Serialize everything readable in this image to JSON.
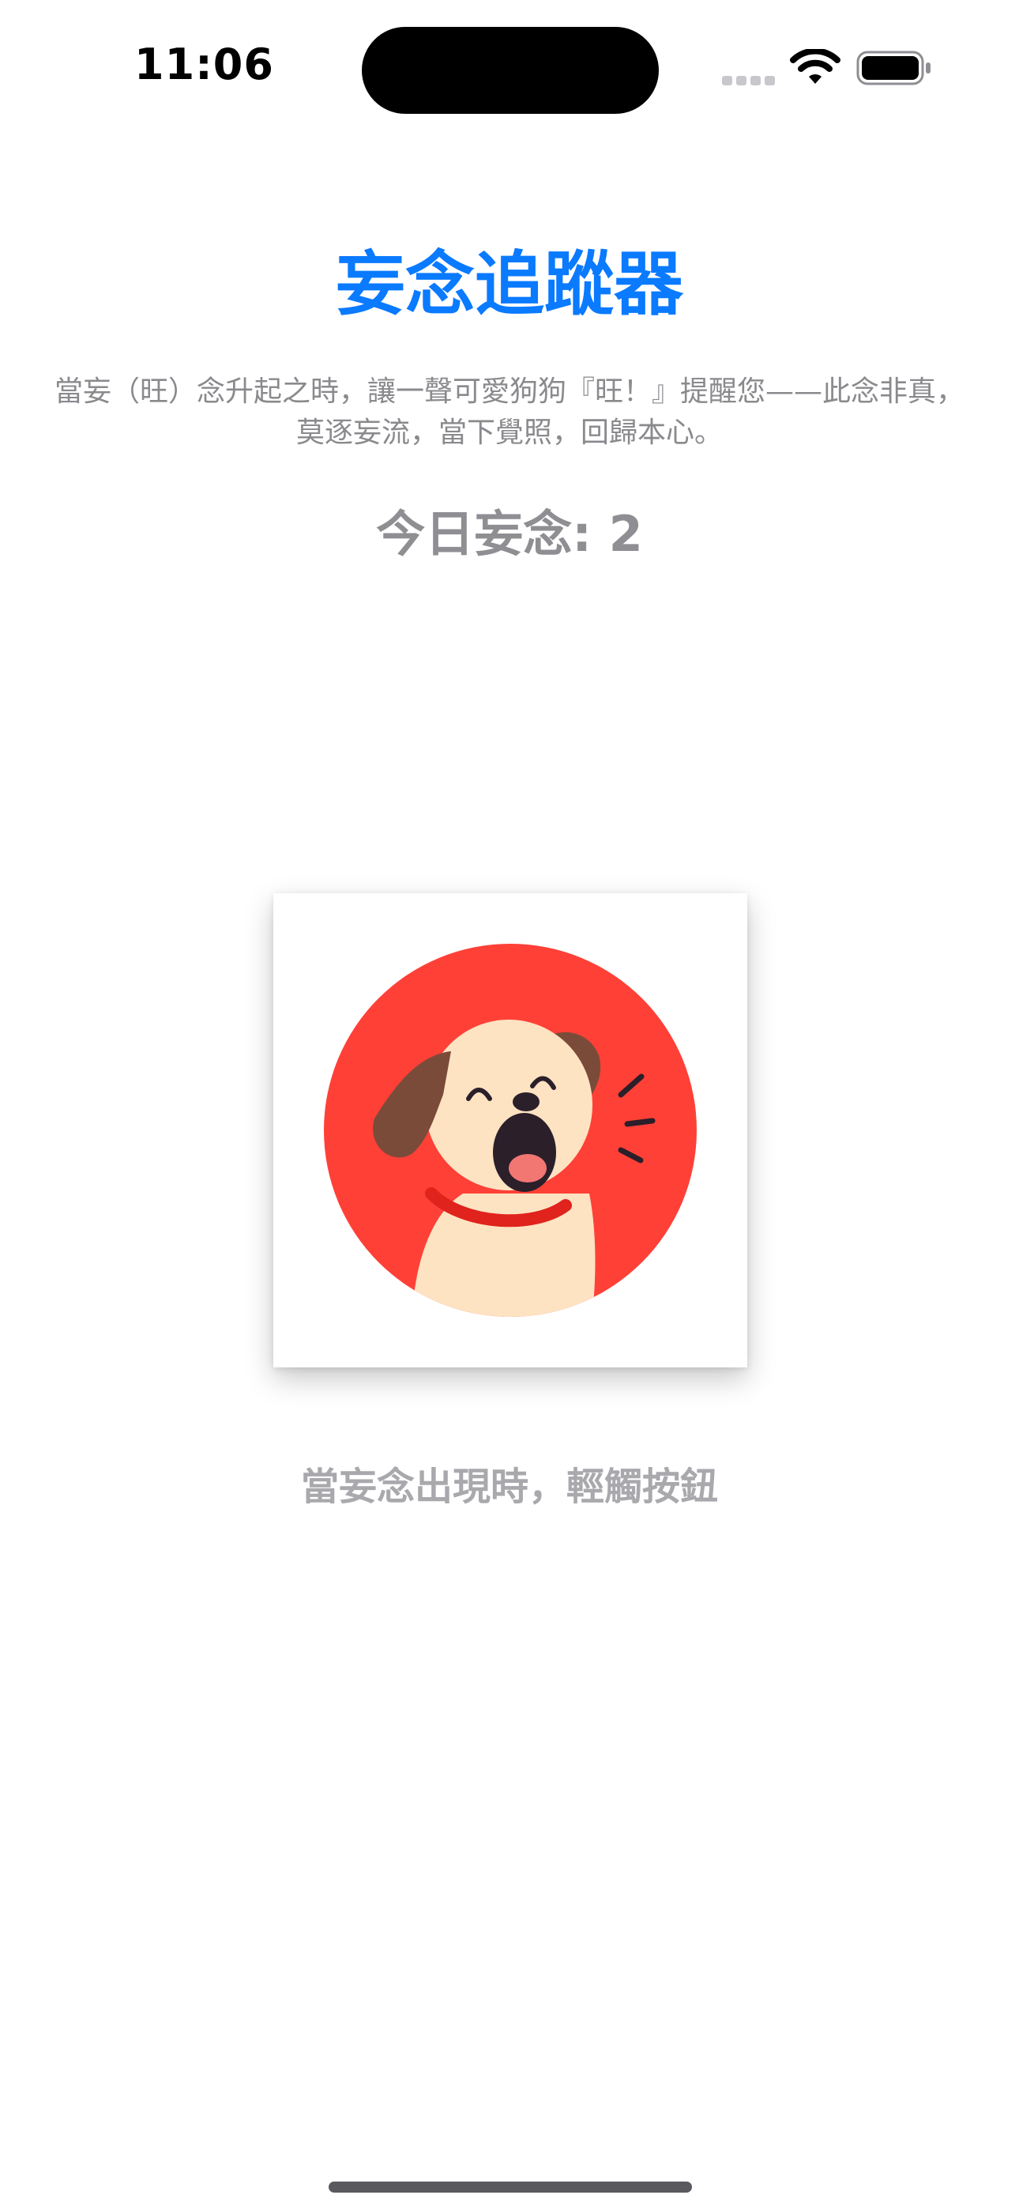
{
  "status_bar": {
    "time": "11:06",
    "icons": [
      "cellular-signal-icon",
      "wifi-icon",
      "battery-icon"
    ]
  },
  "app": {
    "title": "妄念追蹤器",
    "description": "當妄（旺）念升起之時，讓一聲可愛狗狗『旺！』提醒您——此念非真，莫逐妄流，當下覺照，回歸本心。",
    "count_label": "今日妄念: 2",
    "hint": "當妄念出現時，輕觸按鈕"
  },
  "dog_button": {
    "icon": "barking-dog-icon"
  },
  "colors": {
    "title": "#0a7aff",
    "circle": "#ff4037",
    "dog_body": "#fde3c2",
    "dog_ear": "#7b4b3a",
    "collar": "#e0231c"
  }
}
